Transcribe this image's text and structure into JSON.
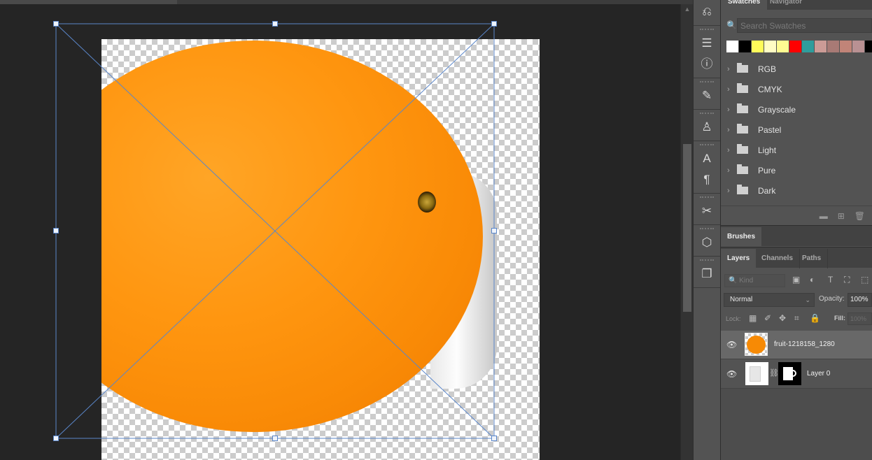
{
  "document": {
    "canvas_label": "canvas",
    "layer_content": "orange photo over mug"
  },
  "scrollbar": {
    "up_arrow": "▲"
  },
  "dock": {
    "icons": [
      "history-icon",
      "adjustments-icon",
      "info-icon",
      "brush-presets-icon",
      "clone-source-icon",
      "character-icon",
      "paragraph-icon",
      "tools-icon",
      "3d-icon",
      "libraries-icon"
    ],
    "glyphs": [
      "⎌",
      "☰",
      "ⓘ",
      "✎",
      "♙",
      "A",
      "¶",
      "✂",
      "⬡",
      "❐"
    ]
  },
  "swatches_panel": {
    "tabs": [
      {
        "label": "Swatches",
        "active": true
      },
      {
        "label": "Navigator",
        "active": false
      }
    ],
    "search_placeholder": "Search Swatches",
    "search_icon": "🔍",
    "colors": [
      "#ffffff",
      "#000000",
      "#fffb5a",
      "#fffcc4",
      "#fffb92",
      "#ff0000",
      "#2f9d9c",
      "#cc9b96",
      "#a87a75",
      "#c18478",
      "#b99193",
      "#000000"
    ],
    "folders": [
      {
        "label": "RGB"
      },
      {
        "label": "CMYK"
      },
      {
        "label": "Grayscale"
      },
      {
        "label": "Pastel"
      },
      {
        "label": "Light"
      },
      {
        "label": "Pure"
      },
      {
        "label": "Dark"
      }
    ],
    "chevron": "›",
    "footer_icons": [
      "▬",
      "⊞",
      "🗑"
    ]
  },
  "brushes_panel": {
    "tab": "Brushes"
  },
  "layers_panel": {
    "tabs": [
      {
        "label": "Layers",
        "active": true
      },
      {
        "label": "Channels",
        "active": false
      },
      {
        "label": "Paths",
        "active": false
      }
    ],
    "filter_kind": "🔍 Kind",
    "filter_icons": [
      "▣",
      "◐",
      "T",
      "⛶",
      "⬚"
    ],
    "blend_mode": "Normal",
    "blend_caret": "⌄",
    "opacity_label": "Opacity:",
    "opacity_value": "100%",
    "lock_label": "Lock:",
    "lock_icons": [
      "▦",
      "✐",
      "✥",
      "⌗",
      "🔒"
    ],
    "fill_label": "Fill:",
    "fill_value": "100%",
    "layers": [
      {
        "name": "fruit-1218158_1280",
        "visible": true,
        "selected": true,
        "eye": "👁"
      },
      {
        "name": "Layer 0",
        "visible": true,
        "selected": false,
        "eye": "👁",
        "has_mask": true,
        "link": "⛓"
      }
    ]
  }
}
